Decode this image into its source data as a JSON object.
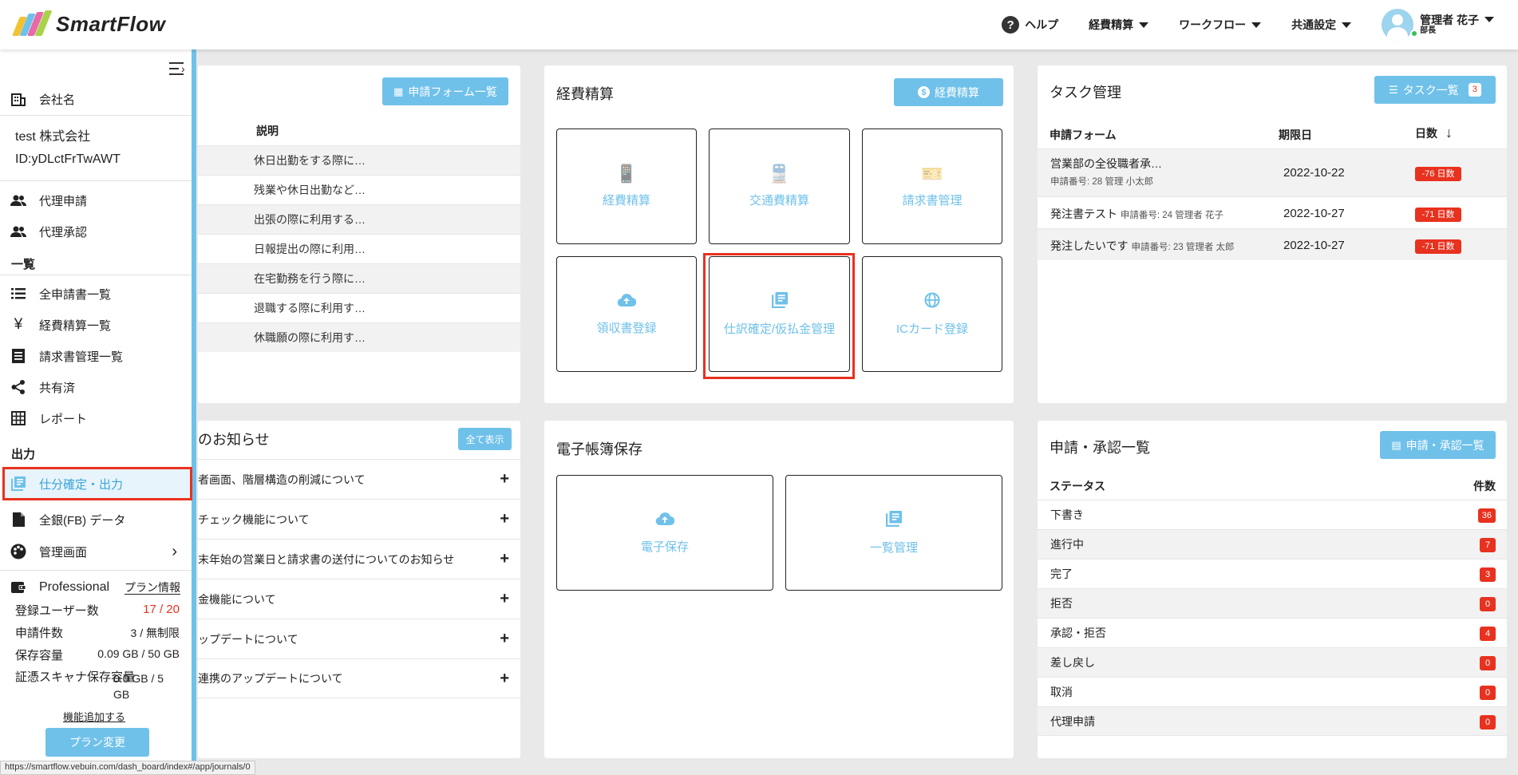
{
  "header": {
    "logo_text": "SmartFlow",
    "help": "ヘルプ",
    "menus": [
      "経費精算",
      "ワークフロー",
      "共通設定"
    ],
    "user_name": "管理者 花子",
    "user_role": "部長"
  },
  "sidebar": {
    "company_label": "会社名",
    "company_name": "test 株式会社",
    "company_id": "ID:yDLctFrTwAWT",
    "proxy_items": [
      "代理申請",
      "代理承認"
    ],
    "list_heading": "一覧",
    "list_items": [
      "全申請書一覧",
      "経費精算一覧",
      "請求書管理一覧",
      "共有済",
      "レポート"
    ],
    "output_heading": "出力",
    "output_items": [
      "仕分確定・出力",
      "全銀(FB) データ"
    ],
    "admin": "管理画面",
    "plan_name": "Professional",
    "plan_info": "プラン情報",
    "stats": [
      {
        "label": "登録ユーザー数",
        "value": "17 / 20"
      },
      {
        "label": "申請件数",
        "value": "3 / 無制限"
      },
      {
        "label": "保存容量",
        "value": "0.09 GB / 50 GB"
      },
      {
        "label": "証憑スキャナ保存容量",
        "value": "0.0 GB / 5 GB"
      }
    ],
    "add_features": "機能追加する",
    "plan_change": "プラン変更"
  },
  "forms_card": {
    "button": "申請フォーム一覧",
    "col_desc": "説明",
    "rows": [
      "休日出勤をする際に…",
      "残業や休日出勤など…",
      "出張の際に利用する…",
      "日報提出の際に利用…",
      "在宅勤務を行う際に…",
      "退職する際に利用す…",
      "休職願の際に利用す…"
    ]
  },
  "expense_card": {
    "title": "経費精算",
    "button": "経費精算",
    "tiles": [
      "経費精算",
      "交通費精算",
      "請求書管理",
      "領収書登録",
      "仕訳確定/仮払金管理",
      "ICカード登録"
    ]
  },
  "task_card": {
    "title": "タスク管理",
    "button": "タスク一覧",
    "count": "3",
    "headers": [
      "申請フォーム",
      "期限日",
      "日数"
    ],
    "rows": [
      {
        "name": "営業部の全役職者承…",
        "sub": "申請番号: 28  管理 小太郎",
        "date": "2022-10-22",
        "days": "-76 日数"
      },
      {
        "name": "発注書テスト",
        "sub": "申請番号: 24  管理者 花子",
        "date": "2022-10-27",
        "days": "-71 日数"
      },
      {
        "name": "発注したいです",
        "sub": "申請番号: 23  管理者 太郎",
        "date": "2022-10-27",
        "days": "-71 日数"
      }
    ]
  },
  "news_card": {
    "title": "のお知らせ",
    "button": "全て表示",
    "items": [
      "者画面、階層構造の削減について",
      "チェック機能について",
      "末年始の営業日と請求書の送付についてのお知らせ",
      "金機能について",
      "ップデートについて",
      "連携のアップデートについて"
    ]
  },
  "ebook_card": {
    "title": "電子帳簿保存",
    "tiles": [
      "電子保存",
      "一覧管理"
    ]
  },
  "approval_card": {
    "title": "申請・承認一覧",
    "button": "申請・承認一覧",
    "col_status": "ステータス",
    "col_count": "件数",
    "rows": [
      {
        "label": "下書き",
        "count": "36"
      },
      {
        "label": "進行中",
        "count": "7"
      },
      {
        "label": "完了",
        "count": "3"
      },
      {
        "label": "拒否",
        "count": "0"
      },
      {
        "label": "承認・拒否",
        "count": "4"
      },
      {
        "label": "差し戻し",
        "count": "0"
      },
      {
        "label": "取消",
        "count": "0"
      },
      {
        "label": "代理申請",
        "count": "0"
      }
    ]
  },
  "status_url": "https://smartflow.vebuin.com/dash_board/index#/app/journals/0",
  "colors": {
    "accent": "#6fc1ea",
    "danger": "#e8321f",
    "background": "#e9e9e9"
  }
}
